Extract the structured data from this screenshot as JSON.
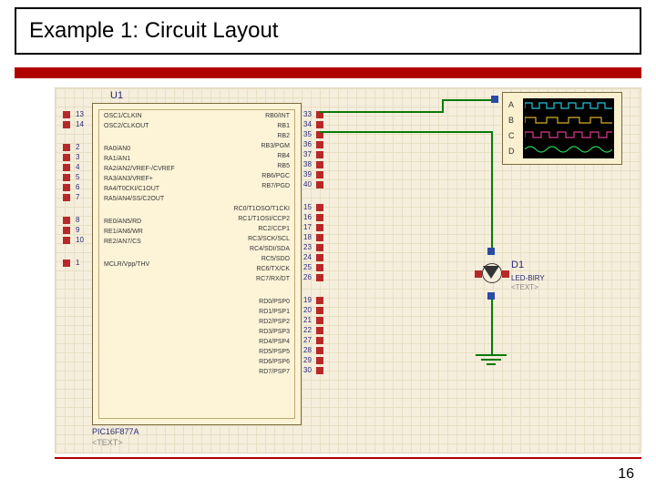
{
  "title": "Example 1: Circuit Layout",
  "page_number": "16",
  "chip": {
    "refdes": "U1",
    "part": "PIC16F877A",
    "value": "<TEXT>",
    "left_groups": [
      {
        "pins": [
          {
            "num": "13",
            "name": "OSC1/CLKIN"
          },
          {
            "num": "14",
            "name": "OSC2/CLKOUT"
          }
        ]
      },
      {
        "pins": [
          {
            "num": "2",
            "name": "RA0/AN0"
          },
          {
            "num": "3",
            "name": "RA1/AN1"
          },
          {
            "num": "4",
            "name": "RA2/AN2/VREF-/CVREF"
          },
          {
            "num": "5",
            "name": "RA3/AN3/VREF+"
          },
          {
            "num": "6",
            "name": "RA4/T0CKI/C1OUT"
          },
          {
            "num": "7",
            "name": "RA5/AN4/SS/C2OUT"
          }
        ]
      },
      {
        "pins": [
          {
            "num": "8",
            "name": "RE0/AN5/RD"
          },
          {
            "num": "9",
            "name": "RE1/AN6/WR"
          },
          {
            "num": "10",
            "name": "RE2/AN7/CS"
          }
        ]
      },
      {
        "pins": [
          {
            "num": "1",
            "name": "MCLR/Vpp/THV"
          }
        ]
      }
    ],
    "right_groups": [
      {
        "pins": [
          {
            "num": "33",
            "name": "RB0/INT"
          },
          {
            "num": "34",
            "name": "RB1"
          },
          {
            "num": "35",
            "name": "RB2"
          },
          {
            "num": "36",
            "name": "RB3/PGM"
          },
          {
            "num": "37",
            "name": "RB4"
          },
          {
            "num": "38",
            "name": "RB5"
          },
          {
            "num": "39",
            "name": "RB6/PGC"
          },
          {
            "num": "40",
            "name": "RB7/PGD"
          }
        ]
      },
      {
        "pins": [
          {
            "num": "15",
            "name": "RC0/T1OSO/T1CKI"
          },
          {
            "num": "16",
            "name": "RC1/T1OSI/CCP2"
          },
          {
            "num": "17",
            "name": "RC2/CCP1"
          },
          {
            "num": "18",
            "name": "RC3/SCK/SCL"
          },
          {
            "num": "23",
            "name": "RC4/SDI/SDA"
          },
          {
            "num": "24",
            "name": "RC5/SDO"
          },
          {
            "num": "25",
            "name": "RC6/TX/CK"
          },
          {
            "num": "26",
            "name": "RC7/RX/DT"
          }
        ]
      },
      {
        "pins": [
          {
            "num": "19",
            "name": "RD0/PSP0"
          },
          {
            "num": "20",
            "name": "RD1/PSP1"
          },
          {
            "num": "21",
            "name": "RD2/PSP2"
          },
          {
            "num": "22",
            "name": "RD3/PSP3"
          },
          {
            "num": "27",
            "name": "RD4/PSP4"
          },
          {
            "num": "28",
            "name": "RD5/PSP5"
          },
          {
            "num": "29",
            "name": "RD6/PSP6"
          },
          {
            "num": "30",
            "name": "RD7/PSP7"
          }
        ]
      }
    ]
  },
  "scope": {
    "channels": [
      "A",
      "B",
      "C",
      "D"
    ]
  },
  "led": {
    "refdes": "D1",
    "type": "LED-BIRY",
    "value": "<TEXT>"
  }
}
